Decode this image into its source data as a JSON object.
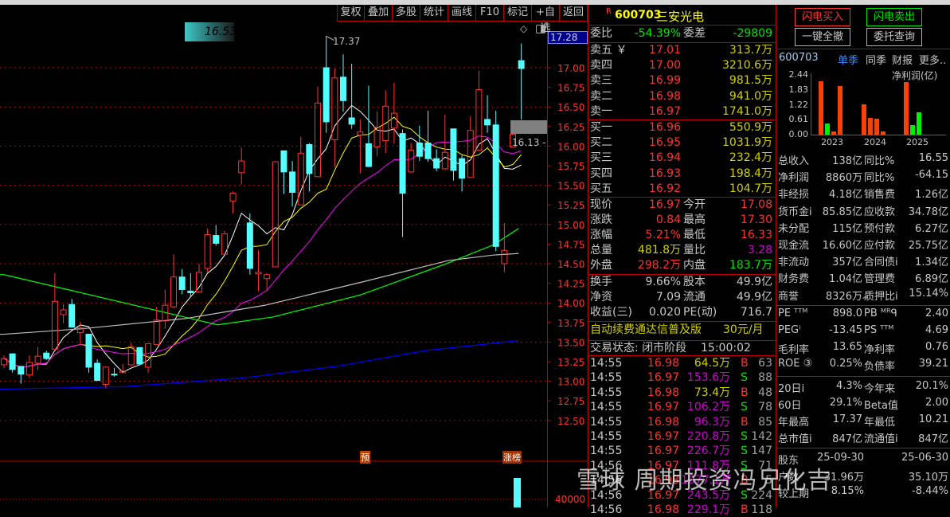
{
  "toolbar": [
    "复权",
    "叠加",
    "多股",
    "统计",
    "画线",
    "F10",
    "标记",
    "+自选",
    "返回"
  ],
  "chart": {
    "price_axis": [
      "17.00",
      "16.75",
      "16.50",
      "16.25",
      "16.00",
      "15.75",
      "15.50",
      "15.25",
      "15.00",
      "14.75",
      "14.50",
      "14.25",
      "14.00",
      "13.75",
      "13.50",
      "13.25",
      "13.00",
      "12.75",
      "12.50"
    ],
    "current_axis_value": "17.28",
    "high_marker": "17.37",
    "cursor_label": "16.53",
    "pending_label": "16.13 - 1",
    "volume_axis": "40000",
    "badges": {
      "forecast": "预",
      "limit_up_list": "涨榜"
    },
    "colors": {
      "up": "#ff3232",
      "down": "#54ffff",
      "ma5": "#ffffff",
      "ma10": "#ffff00",
      "ma20": "#ff00ff",
      "ma60": "#00ff00",
      "ma120": "#c0c0c0",
      "ma250": "#0000ff",
      "grid": "#c00000"
    },
    "candles": [
      [
        13.21,
        13.29,
        13.33,
        13.17
      ],
      [
        13.35,
        13.15,
        13.35,
        13.11
      ],
      [
        13.19,
        13.09,
        13.19,
        12.97
      ],
      [
        13.08,
        13.24,
        13.33,
        13.04
      ],
      [
        13.23,
        13.32,
        13.44,
        13.14
      ],
      [
        13.36,
        13.29,
        13.39,
        13.27
      ],
      [
        13.41,
        14.02,
        14.38,
        13.41
      ],
      [
        13.85,
        13.91,
        13.98,
        13.74
      ],
      [
        13.98,
        13.69,
        14.05,
        13.69
      ],
      [
        13.62,
        13.68,
        13.76,
        13.46
      ],
      [
        13.6,
        13.18,
        13.6,
        13.11
      ],
      [
        13.23,
        13.01,
        13.28,
        13.01
      ],
      [
        12.96,
        13.18,
        13.18,
        12.91
      ],
      [
        13.09,
        13.08,
        13.17,
        13.06
      ],
      [
        13.11,
        13.13,
        13.22,
        13.11
      ],
      [
        13.21,
        13.44,
        13.49,
        13.19
      ],
      [
        13.43,
        13.22,
        13.43,
        13.22
      ],
      [
        13.18,
        13.48,
        13.48,
        13.11
      ],
      [
        13.47,
        13.78,
        13.95,
        13.47
      ],
      [
        13.77,
        13.97,
        14.17,
        13.67
      ],
      [
        13.95,
        14.33,
        14.62,
        13.93
      ],
      [
        14.33,
        14.17,
        14.43,
        14.11
      ],
      [
        14.15,
        14.13,
        14.38,
        14.08
      ],
      [
        14.14,
        14.39,
        14.5,
        14.14
      ],
      [
        14.44,
        14.87,
        14.95,
        14.39
      ],
      [
        14.86,
        14.76,
        14.99,
        14.73
      ],
      [
        14.62,
        14.88,
        14.92,
        14.62
      ],
      [
        15.3,
        15.4,
        15.42,
        15.14
      ],
      [
        15.66,
        15.81,
        15.98,
        15.51
      ],
      [
        15.02,
        14.44,
        15.14,
        14.36
      ],
      [
        14.37,
        14.39,
        14.67,
        14.15
      ],
      [
        14.31,
        14.36,
        14.38,
        14.15
      ],
      [
        14.46,
        15.8,
        15.8,
        14.46
      ],
      [
        15.94,
        15.67,
        15.94,
        15.39
      ],
      [
        15.67,
        15.41,
        15.81,
        15.23
      ],
      [
        15.25,
        15.91,
        16.12,
        15.25
      ],
      [
        16.02,
        15.65,
        16.04,
        15.42
      ],
      [
        15.61,
        16.55,
        16.76,
        15.61
      ],
      [
        17.0,
        16.31,
        17.37,
        16.17
      ],
      [
        16.08,
        16.87,
        16.99,
        15.73
      ],
      [
        16.88,
        16.58,
        17.17,
        16.44
      ],
      [
        16.36,
        16.28,
        17.05,
        16.22
      ],
      [
        16.14,
        16.18,
        16.34,
        15.65
      ],
      [
        16.03,
        15.74,
        16.77,
        15.73
      ],
      [
        15.99,
        16.24,
        16.44,
        15.87
      ],
      [
        16.07,
        16.51,
        16.71,
        15.91
      ],
      [
        16.23,
        16.42,
        16.81,
        16.03
      ],
      [
        16.16,
        15.4,
        16.21,
        14.84
      ],
      [
        15.67,
        15.95,
        16.04,
        15.66
      ],
      [
        16.04,
        15.87,
        16.26,
        15.81
      ],
      [
        16.04,
        15.84,
        16.45,
        15.8
      ],
      [
        15.84,
        15.72,
        15.96,
        15.68
      ],
      [
        15.71,
        15.92,
        16.4,
        15.7
      ],
      [
        16.22,
        15.69,
        16.22,
        15.56
      ],
      [
        15.84,
        15.59,
        15.88,
        15.42
      ],
      [
        15.6,
        16.2,
        16.38,
        15.6
      ],
      [
        15.95,
        16.72,
        16.96,
        15.95
      ],
      [
        16.34,
        16.27,
        16.65,
        16.17
      ],
      [
        16.27,
        14.72,
        16.45,
        14.66
      ],
      [
        14.5,
        14.67,
        15.02,
        14.39
      ],
      [
        15.99,
        16.15,
        16.15,
        15.99
      ],
      [
        17.09,
        16.99,
        17.31,
        16.34
      ]
    ],
    "ma_long": {
      "ma60": [
        [
          0,
          14.36
        ],
        [
          25.2,
          13.72
        ],
        [
          31.7,
          13.82
        ],
        [
          42,
          14.1
        ],
        [
          52.4,
          14.51
        ],
        [
          57.7,
          14.74
        ],
        [
          60.7,
          14.95
        ]
      ],
      "ma120": [
        [
          0,
          13.6
        ],
        [
          9.2,
          13.67
        ],
        [
          21.4,
          13.8
        ],
        [
          30.8,
          13.97
        ],
        [
          42,
          14.26
        ],
        [
          52.4,
          14.54
        ],
        [
          57.7,
          14.61
        ],
        [
          60.7,
          14.63
        ]
      ],
      "ma250": [
        [
          0,
          12.9
        ],
        [
          14,
          12.93
        ],
        [
          28,
          13.04
        ],
        [
          39.2,
          13.19
        ],
        [
          49.6,
          13.39
        ],
        [
          60.7,
          13.52
        ]
      ]
    }
  },
  "quote": {
    "flag": "R",
    "code": "600703",
    "name": "三安光电",
    "weibi_label": "委比",
    "weibi": "-54.39%",
    "weicha_label": "委差",
    "weicha": "-29809",
    "sell": [
      {
        "label": "卖五 ￥",
        "price": "17.01",
        "vol": "313.7万"
      },
      {
        "label": "卖四",
        "price": "17.00",
        "vol": "3210.6万"
      },
      {
        "label": "卖三",
        "price": "16.99",
        "vol": "981.5万"
      },
      {
        "label": "卖二",
        "price": "16.98",
        "vol": "941.0万"
      },
      {
        "label": "卖一",
        "price": "16.97",
        "vol": "1741.0万"
      }
    ],
    "buy": [
      {
        "label": "买一",
        "price": "16.96",
        "vol": "550.9万"
      },
      {
        "label": "买二",
        "price": "16.95",
        "vol": "1031.9万"
      },
      {
        "label": "买三",
        "price": "16.94",
        "vol": "232.4万"
      },
      {
        "label": "买四",
        "price": "16.93",
        "vol": "198.4万"
      },
      {
        "label": "买五",
        "price": "16.92",
        "vol": "104.7万"
      }
    ],
    "stats": [
      {
        "l1": "现价",
        "v1": "16.97",
        "c1": "red",
        "l2": "今开",
        "v2": "17.08",
        "c2": "red"
      },
      {
        "l1": "涨跌",
        "v1": "0.84",
        "c1": "red",
        "l2": "最高",
        "v2": "17.30",
        "c2": "red"
      },
      {
        "l1": "涨幅",
        "v1": "5.21%",
        "c1": "red",
        "l2": "最低",
        "v2": "16.33",
        "c2": "red"
      },
      {
        "l1": "总量",
        "v1": "481.8万",
        "c1": "yel",
        "l2": "量比",
        "v2": "3.28",
        "c2": "mag"
      },
      {
        "l1": "外盘",
        "v1": "298.2万",
        "c1": "red",
        "l2": "内盘",
        "v2": "183.7万",
        "c2": "grn"
      }
    ],
    "stats2": [
      {
        "l1": "换手",
        "v1": "9.66%",
        "l2": "股本",
        "v2": "49.9亿"
      },
      {
        "l1": "净资",
        "v1": "7.09",
        "l2": "流通",
        "v2": "49.9亿"
      },
      {
        "l1": "收益(三)",
        "v1": "0.020",
        "l2": "PE(动)",
        "v2": "716.7"
      }
    ],
    "ad": "自动续费通达信普及版",
    "ad_price": "30元/月",
    "status_label": "交易状态: 闭市阶段",
    "status_time": "15:00:02",
    "ticks": [
      {
        "t": "14:55",
        "p": "16.98",
        "v": "64.5万",
        "vc": "yel",
        "bs": "B",
        "n": "63"
      },
      {
        "t": "14:55",
        "p": "16.97",
        "v": "153.6万",
        "vc": "mag",
        "bs": "S",
        "n": "88"
      },
      {
        "t": "14:55",
        "p": "16.98",
        "v": "73.4万",
        "vc": "yel",
        "bs": "B",
        "n": "48"
      },
      {
        "t": "14:55",
        "p": "16.97",
        "v": "106.2万",
        "vc": "mag",
        "bs": "S",
        "n": "78"
      },
      {
        "t": "14:55",
        "p": "16.98",
        "v": "96.3万",
        "vc": "mag",
        "bs": "B",
        "n": "85"
      },
      {
        "t": "14:55",
        "p": "16.97",
        "v": "220.8万",
        "vc": "mag",
        "bs": "S",
        "n": "142"
      },
      {
        "t": "14:55",
        "p": "16.97",
        "v": "226.7万",
        "vc": "mag",
        "bs": "S",
        "n": "147"
      },
      {
        "t": "14:56",
        "p": "16.97",
        "v": "111.8万",
        "vc": "mag",
        "bs": "S",
        "n": "71"
      },
      {
        "t": "14:56",
        "p": "16.98",
        "v": "1077.1万",
        "vc": "mag",
        "bs": "B",
        "n": "5"
      },
      {
        "t": "14:56",
        "p": "16.97",
        "v": "243.5万",
        "vc": "mag",
        "bs": "S",
        "n": "224"
      },
      {
        "t": "14:56",
        "p": "16.98",
        "v": "229.1万",
        "vc": "mag",
        "bs": "B",
        "n": "118"
      }
    ]
  },
  "side": {
    "buy_btn": "闪电买入",
    "sell_btn": "闪电卖出",
    "cancel_all": "一键全撤",
    "query": "委托查询",
    "code": "600703",
    "tabs": [
      "单季",
      "同季",
      "财报",
      "更多.."
    ],
    "chart_title": "净利润(亿)",
    "fin": [
      [
        "总收入",
        "138亿",
        "同比%",
        "16.55"
      ],
      [
        "净利润",
        "8860万",
        "同比%",
        "-64.15"
      ],
      [
        "非经损",
        "4.18亿",
        "销售费",
        "1.26亿"
      ],
      [
        "货币金i",
        "85.85亿",
        "应收款",
        "34.78亿"
      ],
      [
        "未分配",
        "115亿",
        "预付款",
        "6.27亿"
      ],
      [
        "现金流",
        "16.60亿",
        "应付款",
        "25.75亿"
      ],
      [
        "非流动",
        "357亿",
        "合同债i",
        "1.34亿"
      ],
      [
        "财务费",
        "1.04亿",
        "管理费",
        "6.89亿"
      ],
      [
        "商誉",
        "8326万",
        "质押比i",
        "15.14%"
      ]
    ],
    "expand": "^",
    "val": [
      [
        "PE ᵀᵀᴹ",
        "898.0",
        "PB ᴹᴿᑫ",
        "2.40"
      ],
      [
        "PEGⁱ",
        "-13.45",
        "PS ᵀᵀᴹ",
        "4.69"
      ],
      [
        "毛利率",
        "13.65",
        "净利率",
        "0.76"
      ],
      [
        "ROE ③",
        "0.25%",
        "负债率",
        "39.21"
      ]
    ],
    "perf": [
      [
        "20日i",
        "4.3%",
        "今年来",
        "20.1%"
      ],
      [
        "60日",
        "29.1%",
        "Beta值",
        "2.00"
      ],
      [
        "年最高",
        "17.37",
        "年最低",
        "10.21"
      ],
      [
        "总市值i",
        "847亿",
        "流通值i",
        "847亿"
      ]
    ],
    "holders": [
      [
        "股东",
        "25-09-30",
        "25-06-30"
      ],
      [
        "户数",
        "31.96万",
        "35.10万"
      ],
      [
        "较上期",
        "8.15%",
        "-8.44%"
      ]
    ]
  },
  "watermark": "雪球 周期投资冯兄化吉",
  "chart_data": {
    "type": "bar",
    "title": "净利润(亿)",
    "categories": [
      "2023",
      "2024",
      "2025"
    ],
    "yticks": [
      "2.44",
      "1.83",
      "1.22",
      "0.61",
      "0.00"
    ],
    "ylim": [
      0,
      2.44
    ],
    "groups": [
      [
        2.17,
        0.44,
        0.12,
        1.97
      ],
      [
        1.24,
        0.69,
        0.66,
        0.12
      ],
      [
        2.15,
        0.38,
        0.92
      ]
    ],
    "bar_colors": [
      [
        "#ff4000",
        "#00ee00",
        "#ff4000",
        "#ff4000"
      ],
      [
        "#ff4000",
        "#ff4000",
        "#ff4000",
        "#ff4000"
      ],
      [
        "#ff4000",
        "#00ee00",
        "#00ee00"
      ]
    ]
  }
}
